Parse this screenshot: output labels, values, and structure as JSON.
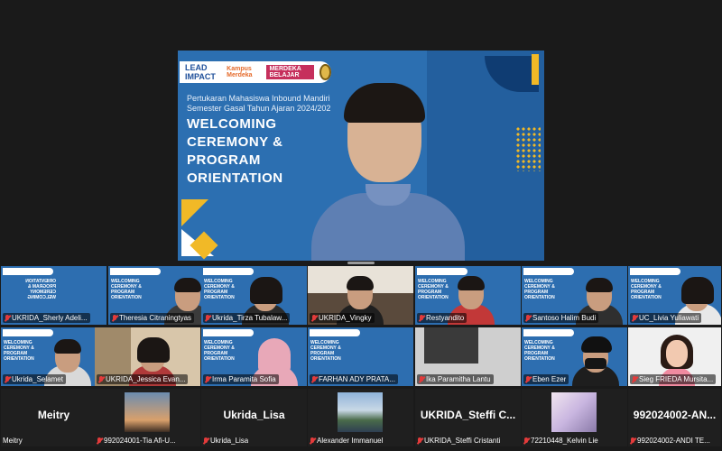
{
  "speaker": {
    "logos": {
      "impact": "LEAD IMPACT",
      "kampus": "Kampus Merdeka",
      "merdeka": "MERDEKA BELAJAR"
    },
    "subtitle_line1": "Pertukaran Mahasiswa Inbound Mandiri",
    "subtitle_line2": "Semester Gasal Tahun Ajaran 2024/202",
    "title_line1": "WELCOMING",
    "title_line2": "CEREMONY &",
    "title_line3": "PROGRAM",
    "title_line4": "ORIENTATION"
  },
  "gallery_row1": [
    {
      "name": "UKRIDA_Sherly Adeli..."
    },
    {
      "name": "Theresia Citraningtyas"
    },
    {
      "name": "Ukrida_Tirza Tubalaw..."
    },
    {
      "name": "UKRIDA_Vingky"
    },
    {
      "name": "Restyandito"
    },
    {
      "name": "Santoso Halim Budi"
    },
    {
      "name": "UC_Livia Yuliawati"
    }
  ],
  "gallery_row2": [
    {
      "name": "Ukrida_Selamet"
    },
    {
      "name": "UKRIDA_Jessica Evan..."
    },
    {
      "name": "Irma Paramita Sofia"
    },
    {
      "name": "FARHAN ADY PRATA..."
    },
    {
      "name": "Ika Paramitha Lantu"
    },
    {
      "name": "Eben Ezer"
    },
    {
      "name": "Sieg FRIEDA Mursita..."
    }
  ],
  "gallery_row3": [
    {
      "display": "Meitry",
      "name": "Meitry"
    },
    {
      "display": "",
      "name": "992024001-Tia Afi-U..."
    },
    {
      "display": "Ukrida_Lisa",
      "name": "Ukrida_Lisa"
    },
    {
      "display": "",
      "name": "Alexander Immanuel"
    },
    {
      "display": "UKRIDA_Steffi C...",
      "name": "UKRIDA_Steffi Cristanti"
    },
    {
      "display": "",
      "name": "72210448_Kelvin Lie"
    },
    {
      "display": "992024002-AN...",
      "name": "992024002-ANDI TE..."
    }
  ],
  "slide_mini_title": "WELCOMING CEREMONY & PROGRAM ORIENTATION",
  "slide_mini_mirror": "ORIENTATION PROGRAM & CEREMONY WELCOMING",
  "colors": {
    "slide_blue": "#2d6eb0",
    "accent_yellow": "#f1b927",
    "muted_red": "#e33b3b",
    "bg": "#1a1a1a"
  }
}
